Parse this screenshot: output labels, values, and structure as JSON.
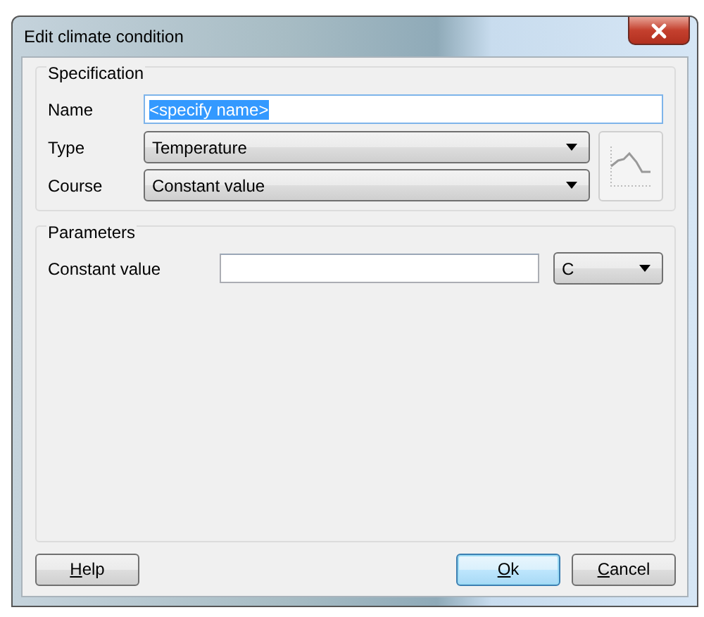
{
  "window": {
    "title": "Edit climate condition"
  },
  "specification": {
    "title": "Specification",
    "name": {
      "label": "Name",
      "value": "<specify name>",
      "selected": true
    },
    "type": {
      "label": "Type",
      "value": "Temperature"
    },
    "course": {
      "label": "Course",
      "value": "Constant value"
    }
  },
  "parameters": {
    "title": "Parameters",
    "constant_value": {
      "label": "Constant value",
      "unit": "C"
    }
  },
  "buttons": [
    {
      "label": "Help",
      "first_letter_underlined": true,
      "default": false
    },
    {
      "label": "Ok",
      "first_letter_underlined": true,
      "default": true
    },
    {
      "label": "Cancel",
      "first_letter_underlined": true,
      "default": false
    }
  ]
}
